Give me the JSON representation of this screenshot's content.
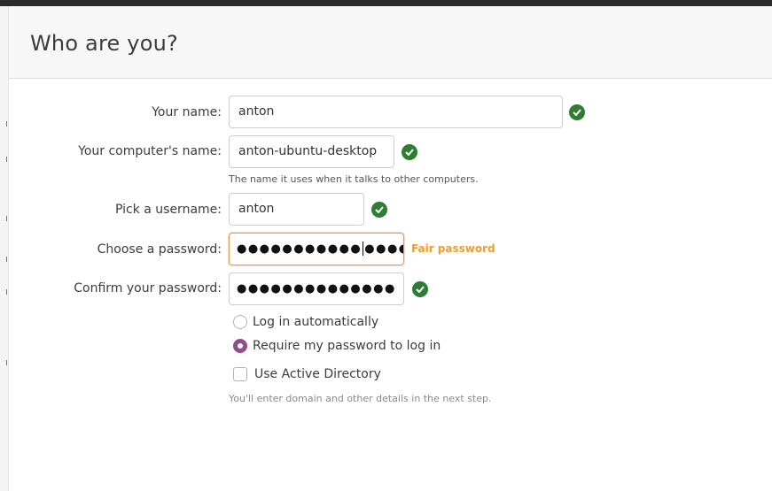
{
  "header": {
    "title": "Who are you?"
  },
  "form": {
    "name_label": "Your name:",
    "name_value": "anton",
    "computer_label": "Your computer's name:",
    "computer_value": "anton-ubuntu-desktop",
    "computer_hint": "The name it uses when it talks to other computers.",
    "username_label": "Pick a username:",
    "username_value": "anton",
    "password_label": "Choose a password:",
    "password_masked_left": "●●●●●●●●●●●",
    "password_masked_right": "●●●●",
    "password_strength": "Fair password",
    "confirm_label": "Confirm your password:",
    "confirm_masked": "●●●●●●●●●●●●●●"
  },
  "login_options": {
    "auto_login_label": "Log in automatically",
    "require_password_label": "Require my password to log in",
    "selected": "Require my password to log in",
    "active_directory_label": "Use Active Directory",
    "active_directory_checked": false,
    "active_directory_hint": "You'll enter domain and other details in the next step."
  },
  "colors": {
    "valid_check": "#2e7d32",
    "strength_warning": "#f29d26",
    "radio_selected": "#924d8b",
    "focus_border": "#e99a5a"
  },
  "icons": {
    "valid": "check-circle-icon"
  }
}
